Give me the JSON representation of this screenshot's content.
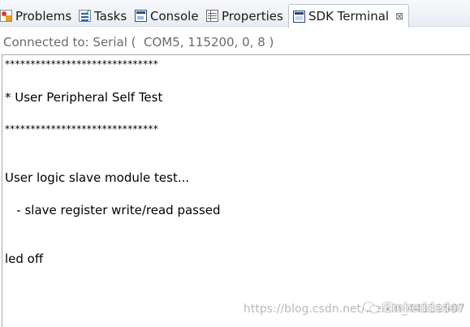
{
  "tabs": [
    {
      "label": "Problems",
      "icon": "problems-icon"
    },
    {
      "label": "Tasks",
      "icon": "tasks-icon"
    },
    {
      "label": "Console",
      "icon": "console-icon"
    },
    {
      "label": "Properties",
      "icon": "properties-icon"
    },
    {
      "label": "SDK Terminal",
      "icon": "sdk-terminal-icon",
      "active": true,
      "close": "⊠"
    }
  ],
  "status": {
    "text": "Connected to: Serial (  COM5, 115200, 0, 8 )"
  },
  "terminal": {
    "lines": [
      "******************************",
      "* User Peripheral Self Test",
      "******************************",
      "User logic slave module test...",
      "   - slave register write/read passed",
      "led off"
    ]
  },
  "watermark": {
    "url": "https://blog.csdn.net/weixin_44111587",
    "brand": "Embeddeder"
  }
}
